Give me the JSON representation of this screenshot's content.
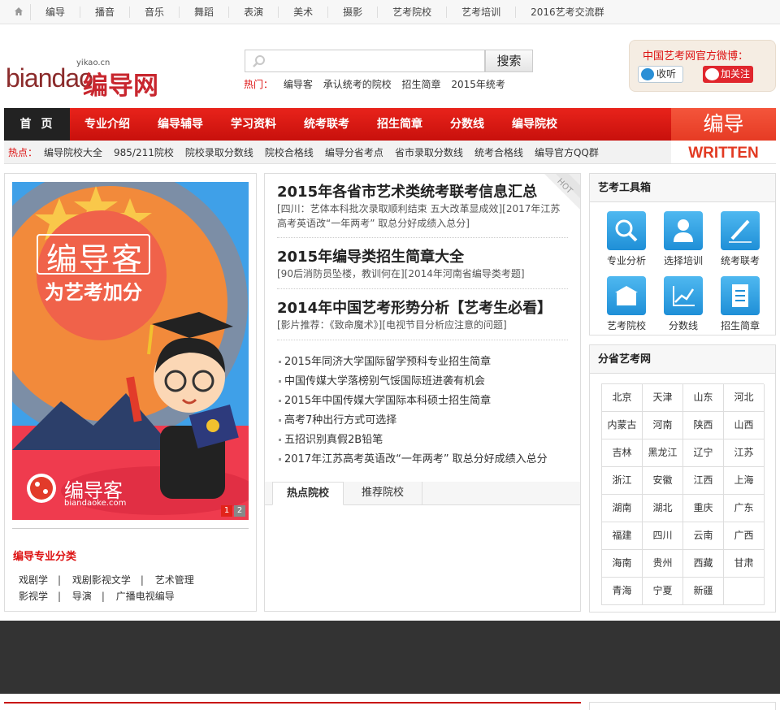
{
  "topbar": {
    "links": [
      "编导",
      "播音",
      "音乐",
      "舞蹈",
      "表演",
      "美术",
      "摄影",
      "艺考院校",
      "艺考培训",
      "2016艺考交流群"
    ]
  },
  "header": {
    "logo_text": "biandao",
    "logo_cn": "编导网",
    "logo_sub": "yikao.cn",
    "search_button": "搜索",
    "search_placeholder": "",
    "hot_label": "热门：",
    "hot_words": [
      "编导客",
      "承认统考的院校",
      "招生简章",
      "2015年统考"
    ],
    "weibo_title": "中国艺考网官方微博：",
    "qq_label": "收听",
    "sina_label": "加关注"
  },
  "nav": {
    "home": "首页",
    "items": [
      "专业介绍",
      "编导辅导",
      "学习资料",
      "统考联考",
      "招生简章",
      "分数线",
      "编导院校"
    ],
    "side_title": "编导",
    "side_sub": "WRITTEN"
  },
  "hotbar": {
    "label": "热点：",
    "links": [
      "编导院校大全",
      "985/211院校",
      "院校录取分数线",
      "院校合格线",
      "编导分省考点",
      "省市录取分数线",
      "统考合格线",
      "编导官方QQ群"
    ]
  },
  "left": {
    "banner_title": "编导客",
    "banner_slogan": "为艺考加分",
    "banner_brand": "编导客",
    "banner_url": "biandaoke.com",
    "pager": [
      "1",
      "2"
    ],
    "category_title": "编导专业分类",
    "categories_row1": [
      "戏剧学",
      "戏剧影视文学",
      "艺术管理"
    ],
    "categories_row2": [
      "影视学",
      "导演",
      "广播电视编导"
    ],
    "separator": "|"
  },
  "middle": {
    "hot_badge": "HOT",
    "headlines": [
      {
        "title": "2015年各省市艺术类统考联考信息汇总",
        "sub": "[四川：艺体本科批次录取顺利结束 五大改革显成效][2017年江苏高考英语改“一年两考” 取总分好成绩入总分]"
      },
      {
        "title": "2015年编导类招生简章大全",
        "sub": "[90后消防员坠楼，教训何在][2014年河南省编导类考题]"
      },
      {
        "title": "2014年中国艺考形势分析【艺考生必看】",
        "sub": "[影片推荐：《致命魔术》][电视节目分析应注意的问题]"
      }
    ],
    "news": [
      "2015年同济大学国际留学预科专业招生简章",
      "中国传媒大学落榜别气馁国际班进袭有机会",
      "2015年中国传媒大学国际本科硕士招生简章",
      "高考7种出行方式可选择",
      "五招识别真假2B铅笔",
      "2017年江苏高考英语改“一年两考” 取总分好成绩入总分"
    ],
    "tab_active": "热点院校",
    "tab_other": "推荐院校"
  },
  "right": {
    "toolbox_title": "艺考工具箱",
    "tools": [
      {
        "label": "专业分析",
        "icon": "magnifier-icon"
      },
      {
        "label": "选择培训",
        "icon": "person-icon"
      },
      {
        "label": "统考联考",
        "icon": "pen-icon"
      },
      {
        "label": "艺考院校",
        "icon": "building-icon"
      },
      {
        "label": "分数线",
        "icon": "chart-icon"
      },
      {
        "label": "招生简章",
        "icon": "document-icon"
      }
    ],
    "province_title": "分省艺考网",
    "provinces": [
      "北京",
      "天津",
      "山东",
      "河北",
      "内蒙古",
      "河南",
      "陕西",
      "山西",
      "吉林",
      "黑龙江",
      "辽宁",
      "江苏",
      "浙江",
      "安徽",
      "江西",
      "上海",
      "湖南",
      "湖北",
      "重庆",
      "广东",
      "福建",
      "四川",
      "云南",
      "广西",
      "海南",
      "贵州",
      "西藏",
      "甘肃",
      "青海",
      "宁夏",
      "新疆",
      ""
    ]
  },
  "colors": {
    "accent": "#c8100c",
    "nav_dark": "#222222",
    "link_red": "#dd1111"
  }
}
